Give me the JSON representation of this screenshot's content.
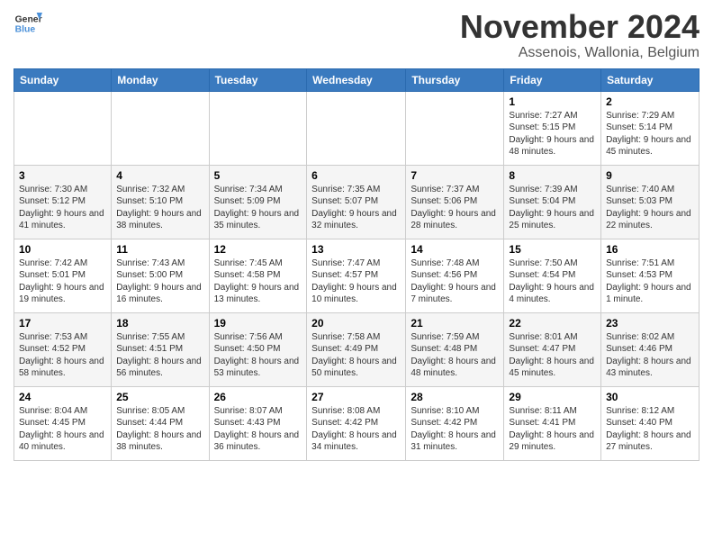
{
  "header": {
    "logo_line1": "General",
    "logo_line2": "Blue",
    "month_title": "November 2024",
    "location": "Assenois, Wallonia, Belgium"
  },
  "days_of_week": [
    "Sunday",
    "Monday",
    "Tuesday",
    "Wednesday",
    "Thursday",
    "Friday",
    "Saturday"
  ],
  "weeks": [
    [
      {
        "day": "",
        "info": ""
      },
      {
        "day": "",
        "info": ""
      },
      {
        "day": "",
        "info": ""
      },
      {
        "day": "",
        "info": ""
      },
      {
        "day": "",
        "info": ""
      },
      {
        "day": "1",
        "info": "Sunrise: 7:27 AM\nSunset: 5:15 PM\nDaylight: 9 hours and 48 minutes."
      },
      {
        "day": "2",
        "info": "Sunrise: 7:29 AM\nSunset: 5:14 PM\nDaylight: 9 hours and 45 minutes."
      }
    ],
    [
      {
        "day": "3",
        "info": "Sunrise: 7:30 AM\nSunset: 5:12 PM\nDaylight: 9 hours and 41 minutes."
      },
      {
        "day": "4",
        "info": "Sunrise: 7:32 AM\nSunset: 5:10 PM\nDaylight: 9 hours and 38 minutes."
      },
      {
        "day": "5",
        "info": "Sunrise: 7:34 AM\nSunset: 5:09 PM\nDaylight: 9 hours and 35 minutes."
      },
      {
        "day": "6",
        "info": "Sunrise: 7:35 AM\nSunset: 5:07 PM\nDaylight: 9 hours and 32 minutes."
      },
      {
        "day": "7",
        "info": "Sunrise: 7:37 AM\nSunset: 5:06 PM\nDaylight: 9 hours and 28 minutes."
      },
      {
        "day": "8",
        "info": "Sunrise: 7:39 AM\nSunset: 5:04 PM\nDaylight: 9 hours and 25 minutes."
      },
      {
        "day": "9",
        "info": "Sunrise: 7:40 AM\nSunset: 5:03 PM\nDaylight: 9 hours and 22 minutes."
      }
    ],
    [
      {
        "day": "10",
        "info": "Sunrise: 7:42 AM\nSunset: 5:01 PM\nDaylight: 9 hours and 19 minutes."
      },
      {
        "day": "11",
        "info": "Sunrise: 7:43 AM\nSunset: 5:00 PM\nDaylight: 9 hours and 16 minutes."
      },
      {
        "day": "12",
        "info": "Sunrise: 7:45 AM\nSunset: 4:58 PM\nDaylight: 9 hours and 13 minutes."
      },
      {
        "day": "13",
        "info": "Sunrise: 7:47 AM\nSunset: 4:57 PM\nDaylight: 9 hours and 10 minutes."
      },
      {
        "day": "14",
        "info": "Sunrise: 7:48 AM\nSunset: 4:56 PM\nDaylight: 9 hours and 7 minutes."
      },
      {
        "day": "15",
        "info": "Sunrise: 7:50 AM\nSunset: 4:54 PM\nDaylight: 9 hours and 4 minutes."
      },
      {
        "day": "16",
        "info": "Sunrise: 7:51 AM\nSunset: 4:53 PM\nDaylight: 9 hours and 1 minute."
      }
    ],
    [
      {
        "day": "17",
        "info": "Sunrise: 7:53 AM\nSunset: 4:52 PM\nDaylight: 8 hours and 58 minutes."
      },
      {
        "day": "18",
        "info": "Sunrise: 7:55 AM\nSunset: 4:51 PM\nDaylight: 8 hours and 56 minutes."
      },
      {
        "day": "19",
        "info": "Sunrise: 7:56 AM\nSunset: 4:50 PM\nDaylight: 8 hours and 53 minutes."
      },
      {
        "day": "20",
        "info": "Sunrise: 7:58 AM\nSunset: 4:49 PM\nDaylight: 8 hours and 50 minutes."
      },
      {
        "day": "21",
        "info": "Sunrise: 7:59 AM\nSunset: 4:48 PM\nDaylight: 8 hours and 48 minutes."
      },
      {
        "day": "22",
        "info": "Sunrise: 8:01 AM\nSunset: 4:47 PM\nDaylight: 8 hours and 45 minutes."
      },
      {
        "day": "23",
        "info": "Sunrise: 8:02 AM\nSunset: 4:46 PM\nDaylight: 8 hours and 43 minutes."
      }
    ],
    [
      {
        "day": "24",
        "info": "Sunrise: 8:04 AM\nSunset: 4:45 PM\nDaylight: 8 hours and 40 minutes."
      },
      {
        "day": "25",
        "info": "Sunrise: 8:05 AM\nSunset: 4:44 PM\nDaylight: 8 hours and 38 minutes."
      },
      {
        "day": "26",
        "info": "Sunrise: 8:07 AM\nSunset: 4:43 PM\nDaylight: 8 hours and 36 minutes."
      },
      {
        "day": "27",
        "info": "Sunrise: 8:08 AM\nSunset: 4:42 PM\nDaylight: 8 hours and 34 minutes."
      },
      {
        "day": "28",
        "info": "Sunrise: 8:10 AM\nSunset: 4:42 PM\nDaylight: 8 hours and 31 minutes."
      },
      {
        "day": "29",
        "info": "Sunrise: 8:11 AM\nSunset: 4:41 PM\nDaylight: 8 hours and 29 minutes."
      },
      {
        "day": "30",
        "info": "Sunrise: 8:12 AM\nSunset: 4:40 PM\nDaylight: 8 hours and 27 minutes."
      }
    ]
  ]
}
